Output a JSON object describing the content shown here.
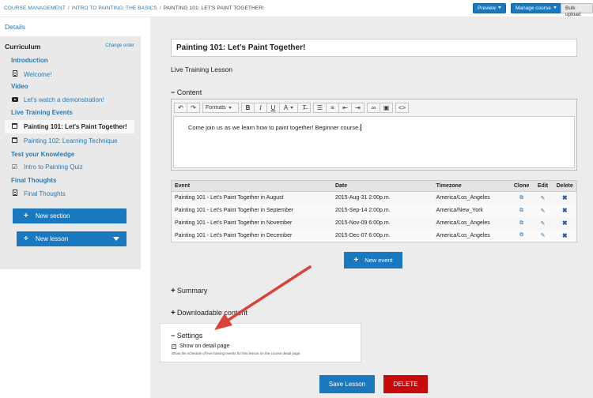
{
  "breadcrumb": {
    "items": [
      "COURSE MANAGEMENT",
      "INTRO TO PAINTING: THE BASICS"
    ],
    "current": "PAINTING 101: LET'S PAINT TOGETHER!",
    "separator": "/"
  },
  "topbar": {
    "preview_label": "Preview",
    "manage_label": "Manage course",
    "bulk_label": "Bulk upload"
  },
  "details_link": "Details",
  "sidebar": {
    "title": "Curriculum",
    "change_order": "Change order",
    "sections": [
      {
        "label": "Introduction",
        "items": [
          {
            "label": "Welcome!",
            "icon": "document-icon"
          }
        ]
      },
      {
        "label": "Video",
        "items": [
          {
            "label": "Let's watch a demonstration!",
            "icon": "youtube-icon"
          }
        ]
      },
      {
        "label": "Live Training Events",
        "items": [
          {
            "label": "Painting 101: Let's Paint Together!",
            "icon": "calendar-icon",
            "active": true
          },
          {
            "label": "Painting 102: Learning Technique",
            "icon": "calendar-icon"
          }
        ]
      },
      {
        "label": "Test your Knowledge",
        "items": [
          {
            "label": "Intro to Painting Quiz",
            "icon": "checkbox-icon"
          }
        ]
      },
      {
        "label": "Final Thoughts",
        "items": [
          {
            "label": "Final Thoughts",
            "icon": "document-icon"
          }
        ]
      }
    ],
    "new_section": "New section",
    "new_lesson": "New lesson"
  },
  "lesson": {
    "title": "Painting 101:  Let's Paint Together!",
    "type": "Live Training Lesson",
    "content_label": "Content",
    "formats_label": "Formats",
    "body": "Come join us as we learn how to paint together! Beginner course."
  },
  "events": {
    "columns": [
      "Event",
      "Date",
      "Timezone",
      "Clone",
      "Edit",
      "Delete"
    ],
    "rows": [
      {
        "event": "Painting 101 - Let's Paint Together in August",
        "date": "2015-Aug-31 2:00p.m.",
        "timezone": "America/Los_Angeles"
      },
      {
        "event": "Painting 101 - Let's Paint Together in September",
        "date": "2015-Sep-14 2:00p.m.",
        "timezone": "America/New_York"
      },
      {
        "event": "Painting 101 - Let's Paint Together in November",
        "date": "2015-Nov-09 6:00p.m.",
        "timezone": "America/Los_Angeles"
      },
      {
        "event": "Painting 101 - Let's Paint Together in December",
        "date": "2015-Dec-07 6:00p.m.",
        "timezone": "America/Los_Angeles"
      }
    ],
    "new_event": "New event"
  },
  "panels": {
    "summary": "Summary",
    "downloadable": "Downloadable content",
    "settings": "Settings",
    "show_on_detail": "Show on detail page",
    "show_help": "Show the schedule of live training events for this lesson on the course detail page."
  },
  "actions": {
    "save": "Save Lesson",
    "delete": "DELETE"
  },
  "colors": {
    "primary": "#1a78bf",
    "danger": "#c90a0a",
    "link": "#2a7ab0",
    "annotation": "#d9433a"
  }
}
